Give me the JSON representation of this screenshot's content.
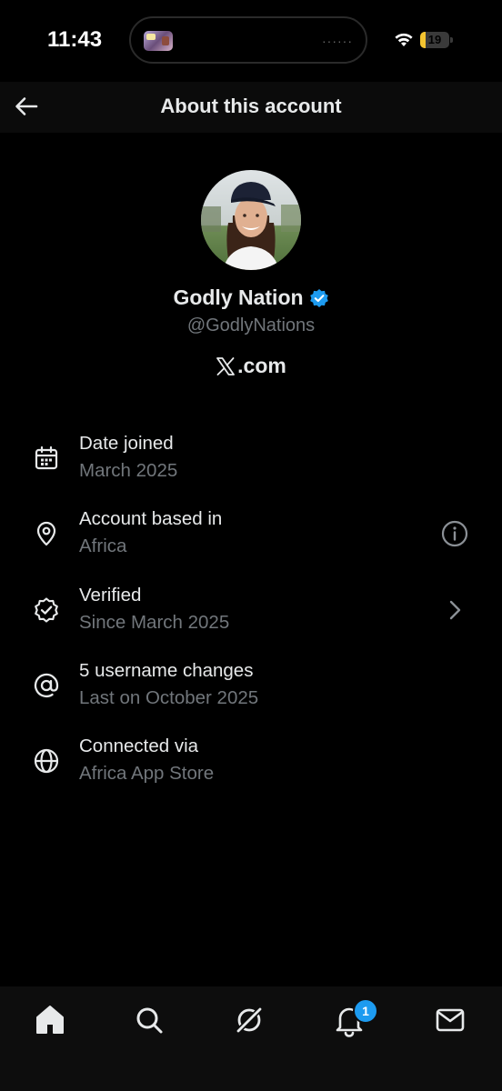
{
  "status_bar": {
    "time": "11:43",
    "battery": "19",
    "battery_level_percent": 19,
    "battery_color": "#f4c430",
    "island_dots": "······"
  },
  "header": {
    "back_icon": "arrow-left-icon",
    "title": "About this account"
  },
  "profile": {
    "avatar_icon": "profile-photo",
    "display_name": "Godly Nation",
    "verified_icon": "verified-badge-icon",
    "verified_color": "#1d9bf0",
    "handle": "@GodlyNations",
    "site_logo": "x-logo-icon",
    "site_suffix": ".com"
  },
  "info_rows": [
    {
      "icon": "calendar-icon",
      "title": "Date joined",
      "subtitle": "March 2025",
      "action": null
    },
    {
      "icon": "location-pin-icon",
      "title": "Account based in",
      "subtitle": "Africa",
      "action": "info-icon"
    },
    {
      "icon": "verified-check-icon",
      "title": "Verified",
      "subtitle": "Since March 2025",
      "action": "chevron-right-icon"
    },
    {
      "icon": "at-sign-icon",
      "title": "5 username changes",
      "subtitle": "Last on October 2025",
      "action": null
    },
    {
      "icon": "globe-icon",
      "title": "Connected via",
      "subtitle": "Africa App Store",
      "action": null
    }
  ],
  "bottom_nav": {
    "items": [
      "home-icon",
      "search-icon",
      "grok-icon",
      "notifications-bell-icon",
      "messages-mail-icon"
    ],
    "notification_badge": "1",
    "badge_color": "#1d9bf0"
  },
  "colors": {
    "background": "#000000",
    "primary_text": "#e7e9ea",
    "secondary_text": "#71767b"
  }
}
